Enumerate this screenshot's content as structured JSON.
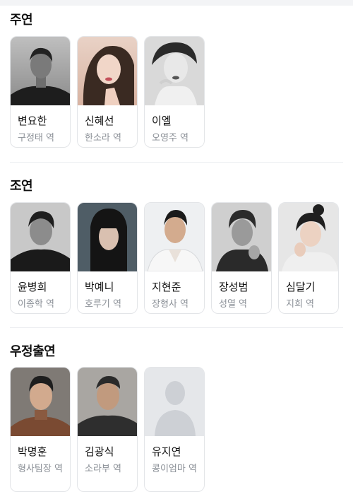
{
  "sections": [
    {
      "title": "주연",
      "cast": [
        {
          "name": "변요한",
          "role": "구정태 역",
          "photo": "actor-photo"
        },
        {
          "name": "신혜선",
          "role": "한소라 역",
          "photo": "actor-photo"
        },
        {
          "name": "이엘",
          "role": "오영주 역",
          "photo": "actor-photo"
        }
      ]
    },
    {
      "title": "조연",
      "cast": [
        {
          "name": "윤병희",
          "role": "이종학 역",
          "photo": "actor-photo"
        },
        {
          "name": "박예니",
          "role": "호루기 역",
          "photo": "actor-photo"
        },
        {
          "name": "지현준",
          "role": "장형사 역",
          "photo": "actor-photo"
        },
        {
          "name": "장성범",
          "role": "성열 역",
          "photo": "actor-photo"
        },
        {
          "name": "심달기",
          "role": "지희 역",
          "photo": "actor-photo"
        }
      ]
    },
    {
      "title": "우정출연",
      "cast": [
        {
          "name": "박명훈",
          "role": "형사팀장 역",
          "photo": "actor-photo"
        },
        {
          "name": "김광식",
          "role": "소라부 역",
          "photo": "actor-photo"
        },
        {
          "name": "유지연",
          "role": "콩이엄마 역",
          "photo": "default-person-icon"
        }
      ]
    }
  ],
  "colors": {
    "card_border": "#e3e5e8",
    "role_text": "#8a8f96",
    "placeholder_bg": "#e5e7ea",
    "placeholder_figure": "#cdd0d5"
  }
}
